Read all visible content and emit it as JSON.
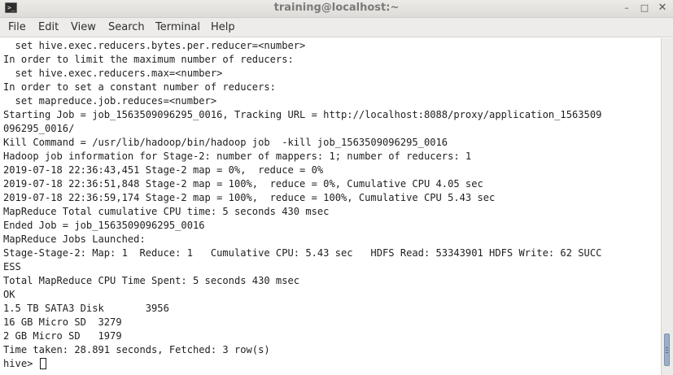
{
  "window": {
    "title": "training@localhost:~",
    "icon": "terminal-icon",
    "controls": {
      "minimize": "–",
      "maximize": "□",
      "close": "✕"
    }
  },
  "menu": [
    "File",
    "Edit",
    "View",
    "Search",
    "Terminal",
    "Help"
  ],
  "terminal": {
    "lines": [
      "  set hive.exec.reducers.bytes.per.reducer=<number>",
      "In order to limit the maximum number of reducers:",
      "  set hive.exec.reducers.max=<number>",
      "In order to set a constant number of reducers:",
      "  set mapreduce.job.reduces=<number>",
      "Starting Job = job_1563509096295_0016, Tracking URL = http://localhost:8088/proxy/application_1563509",
      "096295_0016/",
      "Kill Command = /usr/lib/hadoop/bin/hadoop job  -kill job_1563509096295_0016",
      "Hadoop job information for Stage-2: number of mappers: 1; number of reducers: 1",
      "2019-07-18 22:36:43,451 Stage-2 map = 0%,  reduce = 0%",
      "2019-07-18 22:36:51,848 Stage-2 map = 100%,  reduce = 0%, Cumulative CPU 4.05 sec",
      "2019-07-18 22:36:59,174 Stage-2 map = 100%,  reduce = 100%, Cumulative CPU 5.43 sec",
      "MapReduce Total cumulative CPU time: 5 seconds 430 msec",
      "Ended Job = job_1563509096295_0016",
      "MapReduce Jobs Launched:",
      "Stage-Stage-2: Map: 1  Reduce: 1   Cumulative CPU: 5.43 sec   HDFS Read: 53343901 HDFS Write: 62 SUCC",
      "ESS",
      "Total MapReduce CPU Time Spent: 5 seconds 430 msec",
      "OK",
      "1.5 TB SATA3 Disk       3956",
      "16 GB Micro SD  3279",
      "2 GB Micro SD   1979",
      "Time taken: 28.891 seconds, Fetched: 3 row(s)"
    ],
    "prompt": "hive> "
  },
  "scrollbar": {
    "position": "bottom"
  }
}
